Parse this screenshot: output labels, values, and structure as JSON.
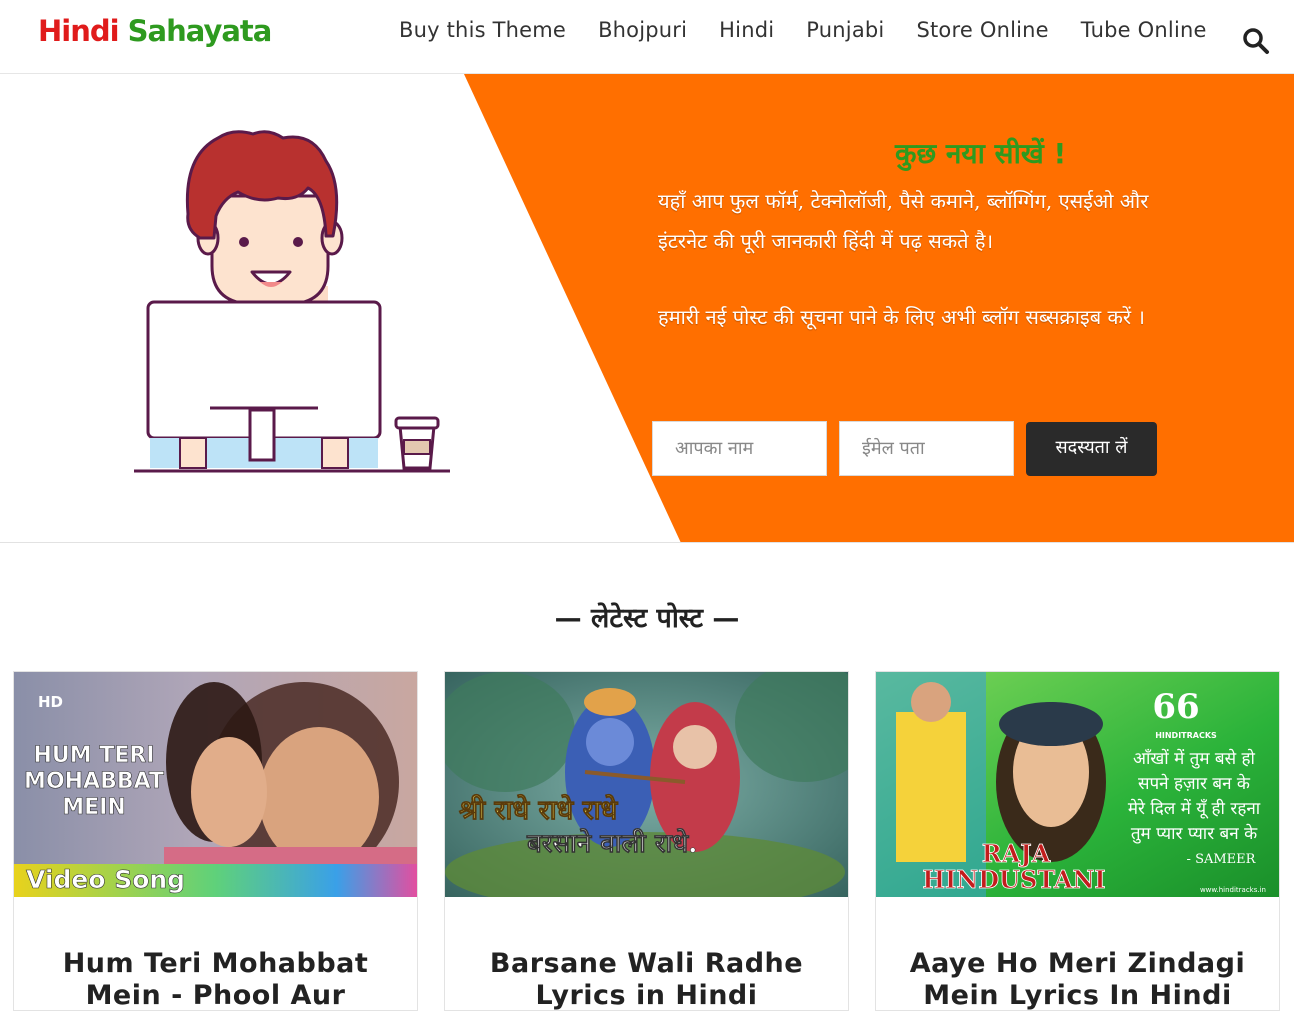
{
  "header": {
    "logo_part1": "Hindi",
    "logo_part2": "Sahayata",
    "nav": [
      "Buy this Theme",
      "Bhojpuri",
      "Hindi",
      "Punjabi",
      "Store Online",
      "Tube Online"
    ],
    "search_icon": "search-icon"
  },
  "hero": {
    "title_part1": "कुछ नया",
    "title_part2": "सीखें !",
    "para1": "यहाँ आप फुल फॉर्म, टेक्नोलॉजी, पैसे कमाने, ब्लॉग्गिंग, एसईओ और इंटरनेट की पूरी जानकारी हिंदी में पढ़ सकते है।",
    "para2": "हमारी नई पोस्ट की सूचना पाने के लिए अभी ब्लॉग सब्सक्राइब करें ।",
    "name_placeholder": "आपका नाम",
    "email_placeholder": "ईमेल पता",
    "subscribe_label": "सदस्यता लें",
    "accent_color": "#ff6f00"
  },
  "latest": {
    "heading": "— लेटेस्ट पोस्ट —",
    "cards": [
      {
        "title": "Hum Teri Mohabbat Mein - Phool Aur",
        "image_text": {
          "hd": "HD",
          "line1": "HUM TERI",
          "line2": "MOHABBAT",
          "line3": "MEIN",
          "tag": "Video Song"
        }
      },
      {
        "title": "Barsane Wali Radhe Lyrics in Hindi",
        "image_text": {
          "line1": "श्री राधे राधे राधे",
          "line2": "बरसाने वाली राधे."
        }
      },
      {
        "title": "Aaye Ho Meri Zindagi Mein Lyrics In Hindi",
        "image_text": {
          "brand": "HINDITRACKS",
          "l1": "आँखों में तुम बसे हो",
          "l2": "सपने हज़ार बन के",
          "l3": "मेरे दिल में यूँ ही रहना",
          "l4": "तुम प्यार प्यार बन के",
          "author": "- SAMEER",
          "movie1": "RAJA",
          "movie2": "HINDUSTANI",
          "site": "www.hinditracks.in"
        }
      }
    ]
  }
}
